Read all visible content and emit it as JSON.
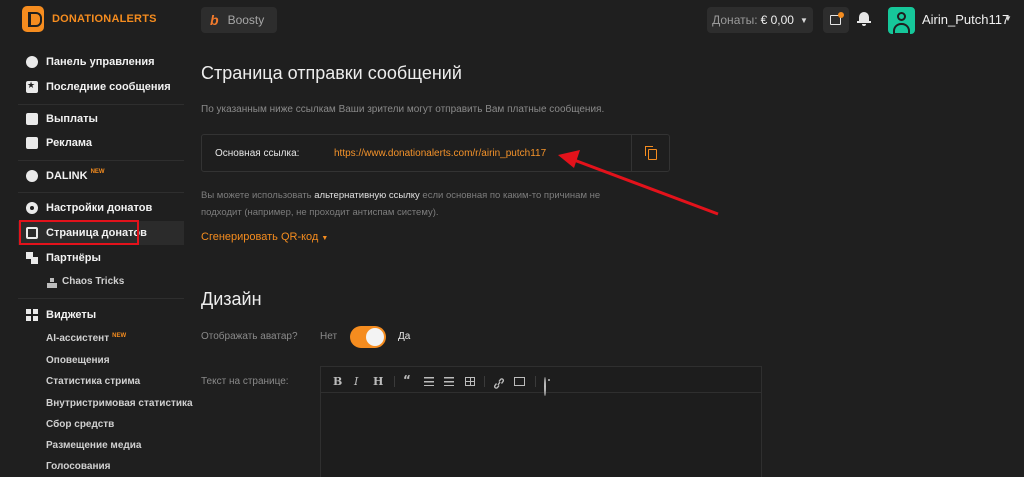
{
  "header": {
    "logo_text": "DONATIONALERTS",
    "boosty_label": "Boosty",
    "donates_label": "Донаты:",
    "donates_value": "€ 0,00",
    "username": "Airin_Putch117"
  },
  "sidebar": {
    "items": [
      {
        "label": "Панель управления",
        "icon": "dashboard-icon"
      },
      {
        "label": "Последние сообщения",
        "icon": "star-icon"
      },
      {
        "label": "Выплаты",
        "icon": "wallet-icon"
      },
      {
        "label": "Реклама",
        "icon": "briefcase-icon"
      },
      {
        "label": "DALINK",
        "badge": "NEW",
        "icon": "dalink-icon"
      },
      {
        "label": "Настройки донатов",
        "icon": "gear-icon"
      },
      {
        "label": "Страница донатов",
        "icon": "page-icon",
        "active": true
      },
      {
        "label": "Партнёры",
        "icon": "partners-icon"
      },
      {
        "label": "Виджеты",
        "icon": "widgets-icon"
      }
    ],
    "partners_sub": [
      "Chaos Tricks"
    ],
    "widgets_sub": [
      {
        "label": "AI-ассистент",
        "badge": "NEW"
      },
      {
        "label": "Оповещения"
      },
      {
        "label": "Статистика стрима"
      },
      {
        "label": "Внутристримовая статистика"
      },
      {
        "label": "Сбор средств"
      },
      {
        "label": "Размещение медиа"
      },
      {
        "label": "Голосования"
      }
    ]
  },
  "main": {
    "title": "Страница отправки сообщений",
    "subtitle": "По указанным ниже ссылкам Ваши зрители могут отправить Вам платные сообщения.",
    "link_label": "Основная ссылка:",
    "link_url": "https://www.donationalerts.com/r/airin_putch117",
    "alt_text_before": "Вы можете использовать ",
    "alt_text_strong": "альтернативную ссылку",
    "alt_text_after": " если основная по каким-то причинам не подходит (например, не проходит антиспам систему).",
    "qr_label": "Сгенерировать QR-код",
    "design_title": "Дизайн",
    "avatar_label": "Отображать аватар?",
    "toggle_off": "Нет",
    "toggle_on": "Да",
    "avatar_enabled": true,
    "text_label": "Текст на странице:",
    "toolbar": {
      "bold": "B",
      "italic": "I",
      "heading": "H"
    }
  },
  "colors": {
    "accent": "#f58c1f",
    "background": "#1f1f1f",
    "highlight": "#e3121b"
  }
}
